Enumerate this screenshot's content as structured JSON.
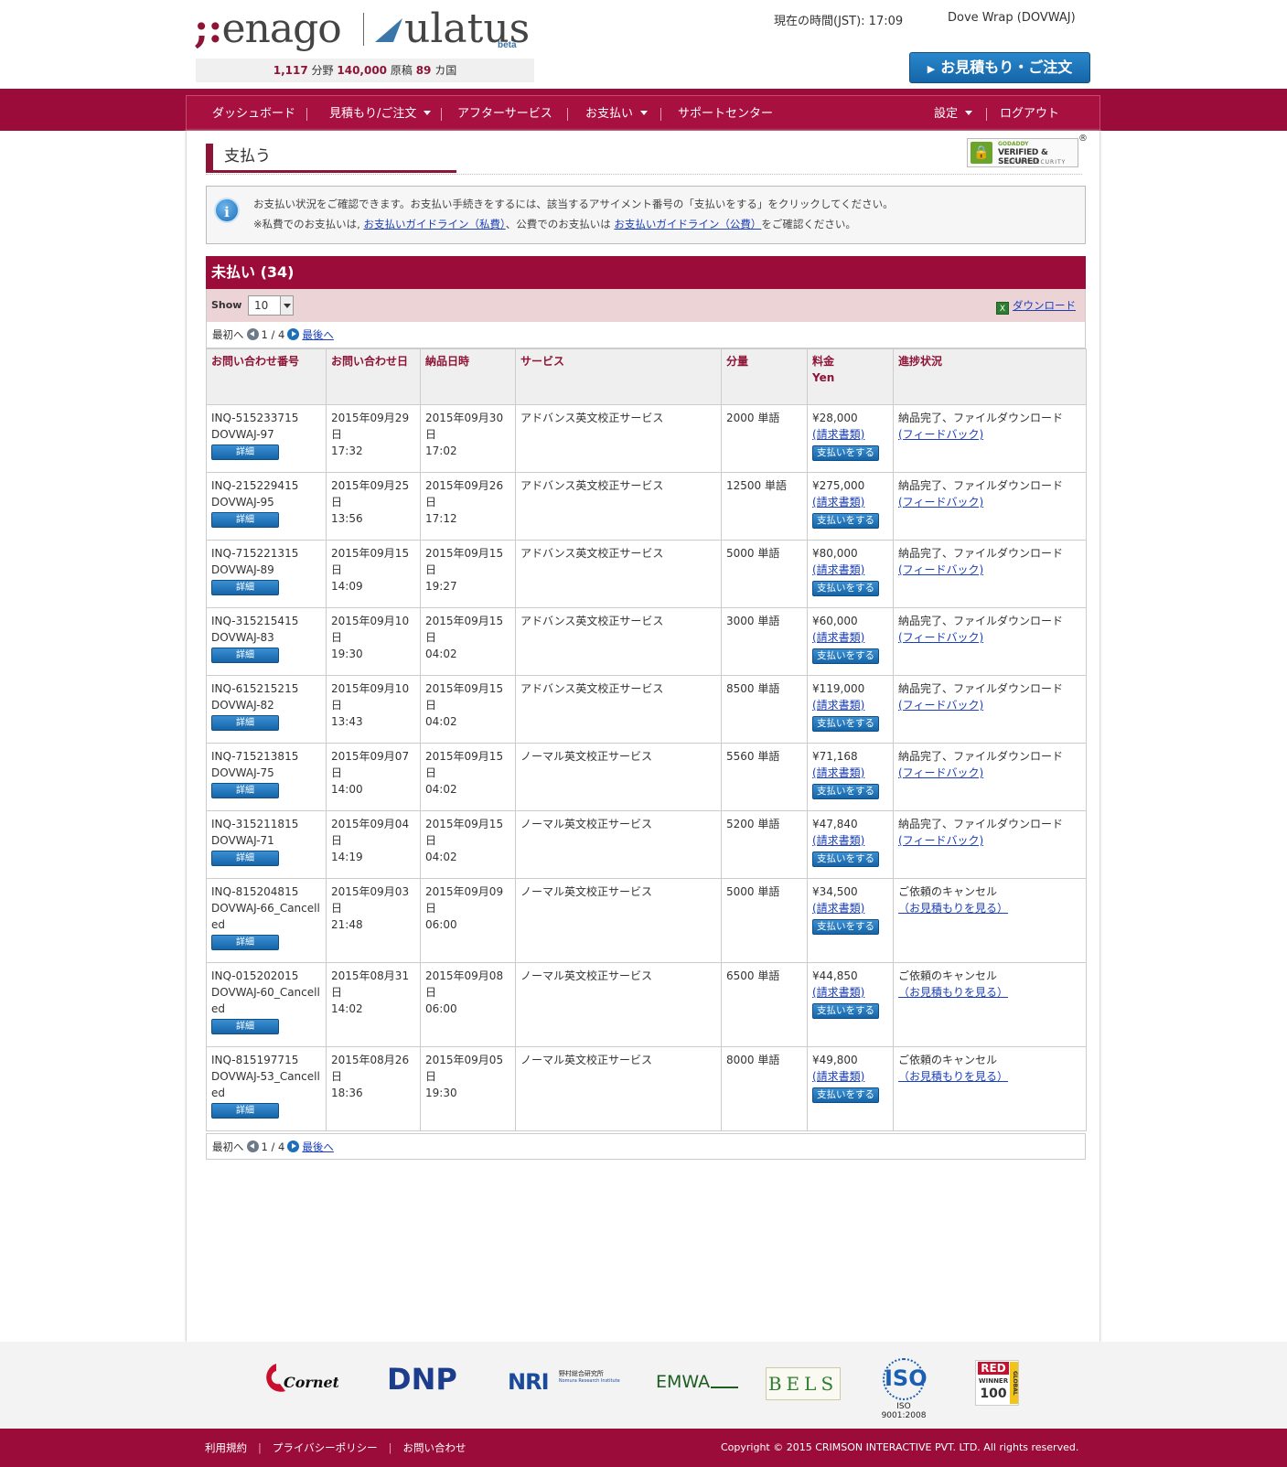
{
  "header": {
    "brand_left": "enago",
    "brand_right": "ulatus",
    "brand_beta": "beta",
    "stats": {
      "fields": "1,117",
      "fields_label": "分野",
      "manuscripts": "140,000",
      "manuscripts_label": "原稿",
      "countries": "89",
      "countries_label": "カ国"
    },
    "clock": "現在の時間(JST): 17:09",
    "user": "Dove Wrap (DOVWAJ)",
    "order_button": "お見積もり・ご注文"
  },
  "nav": {
    "items": [
      "ダッシュボード",
      "見積もり/ご注文",
      "アフターサービス",
      "お支払い",
      "サポートセンター"
    ],
    "settings": "設定",
    "logout": "ログアウト"
  },
  "page": {
    "title": "支払う",
    "badge": {
      "line1": "GODADDY",
      "line2": "VERIFIED & SECURED",
      "line3": "VERIFY SECURITY"
    },
    "info": {
      "line1": "お支払い状況をご確認できます。お支払い手続きをするには、該当するアサイメント番号の「支払いをする」をクリックしてください。",
      "line2_a": "※私費でのお支払いは,",
      "link_private": "お支払いガイドライン（私費）",
      "line2_b": "、公費でのお支払いは",
      "link_public": "お支払いガイドライン（公費）",
      "line2_c": "をご確認ください。"
    }
  },
  "unpaid": {
    "title": "未払い (34)",
    "show_label": "Show",
    "show_value": "10",
    "download": "ダウンロード",
    "pager": {
      "first": "最初へ",
      "page": "1 / 4",
      "last": "最後へ"
    },
    "columns": [
      "お問い合わせ番号",
      "お問い合わせ日",
      "納品日時",
      "サービス",
      "分量",
      "料金",
      "進捗状況"
    ],
    "currency_sub": "Yen",
    "detail_label": "詳細",
    "invoice_label": "(請求書類)",
    "pay_label": "支払いをする",
    "rows": [
      {
        "inq": "INQ-515233715",
        "ref": "DOVWAJ-97",
        "date": "2015年09月29日",
        "time": "17:32",
        "del_date": "2015年09月30日",
        "del_time": "17:02",
        "service": "アドバンス英文校正サービス",
        "qty": "2000 単語",
        "fee": "¥28,000",
        "status": "納品完了、ファイルダウンロード",
        "status_link": "(フィードバック)"
      },
      {
        "inq": "INQ-215229415",
        "ref": "DOVWAJ-95",
        "date": "2015年09月25日",
        "time": "13:56",
        "del_date": "2015年09月26日",
        "del_time": "17:12",
        "service": "アドバンス英文校正サービス",
        "qty": "12500 単語",
        "fee": "¥275,000",
        "status": "納品完了、ファイルダウンロード",
        "status_link": "(フィードバック)"
      },
      {
        "inq": "INQ-715221315",
        "ref": "DOVWAJ-89",
        "date": "2015年09月15日",
        "time": "14:09",
        "del_date": "2015年09月15日",
        "del_time": "19:27",
        "service": "アドバンス英文校正サービス",
        "qty": "5000 単語",
        "fee": "¥80,000",
        "status": "納品完了、ファイルダウンロード",
        "status_link": "(フィードバック)"
      },
      {
        "inq": "INQ-315215415",
        "ref": "DOVWAJ-83",
        "date": "2015年09月10日",
        "time": "19:30",
        "del_date": "2015年09月15日",
        "del_time": "04:02",
        "service": "アドバンス英文校正サービス",
        "qty": "3000 単語",
        "fee": "¥60,000",
        "status": "納品完了、ファイルダウンロード",
        "status_link": "(フィードバック)"
      },
      {
        "inq": "INQ-615215215",
        "ref": "DOVWAJ-82",
        "date": "2015年09月10日",
        "time": "13:43",
        "del_date": "2015年09月15日",
        "del_time": "04:02",
        "service": "アドバンス英文校正サービス",
        "qty": "8500 単語",
        "fee": "¥119,000",
        "status": "納品完了、ファイルダウンロード",
        "status_link": "(フィードバック)"
      },
      {
        "inq": "INQ-715213815",
        "ref": "DOVWAJ-75",
        "date": "2015年09月07日",
        "time": "14:00",
        "del_date": "2015年09月15日",
        "del_time": "04:02",
        "service": "ノーマル英文校正サービス",
        "qty": "5560 単語",
        "fee": "¥71,168",
        "status": "納品完了、ファイルダウンロード",
        "status_link": "(フィードバック)"
      },
      {
        "inq": "INQ-315211815",
        "ref": "DOVWAJ-71",
        "date": "2015年09月04日",
        "time": "14:19",
        "del_date": "2015年09月15日",
        "del_time": "04:02",
        "service": "ノーマル英文校正サービス",
        "qty": "5200 単語",
        "fee": "¥47,840",
        "status": "納品完了、ファイルダウンロード",
        "status_link": "(フィードバック)"
      },
      {
        "inq": "INQ-815204815",
        "ref": "DOVWAJ-66_Cancelled",
        "date": "2015年09月03日",
        "time": "21:48",
        "del_date": "2015年09月09日",
        "del_time": "06:00",
        "service": "ノーマル英文校正サービス",
        "qty": "5000 単語",
        "fee": "¥34,500",
        "status": "ご依頼のキャンセル",
        "status_link": "（お見積もりを見る）"
      },
      {
        "inq": "INQ-015202015",
        "ref": "DOVWAJ-60_Cancelled",
        "date": "2015年08月31日",
        "time": "14:02",
        "del_date": "2015年09月08日",
        "del_time": "06:00",
        "service": "ノーマル英文校正サービス",
        "qty": "6500 単語",
        "fee": "¥44,850",
        "status": "ご依頼のキャンセル",
        "status_link": "（お見積もりを見る）"
      },
      {
        "inq": "INQ-815197715",
        "ref": "DOVWAJ-53_Cancelled",
        "date": "2015年08月26日",
        "time": "18:36",
        "del_date": "2015年09月05日",
        "del_time": "19:30",
        "service": "ノーマル英文校正サービス",
        "qty": "8000 単語",
        "fee": "¥49,800",
        "status": "ご依頼のキャンセル",
        "status_link": "（お見積もりを見る）"
      }
    ]
  },
  "partners": {
    "cornetis": "Cornetis",
    "dnp": "DNP",
    "nri": "NRI",
    "nri_sub": "野村総合研究所",
    "nri_sub_en": "Nomura Research Institute",
    "emwa": "EMWA",
    "bels": "BELS",
    "iso": "ISO",
    "iso_caption": "ISO 9001:2008",
    "red": "RED",
    "red_sub": "WINNER",
    "red_num": "100",
    "red_global": "GLOBAL"
  },
  "footer": {
    "links": [
      "利用規約",
      "プライバシーポリシー",
      "お問い合わせ"
    ],
    "copyright": "Copyright © 2015 CRIMSON INTERACTIVE PVT. LTD. All rights reserved."
  },
  "colors": {
    "brand": "#9b0c3a",
    "button": "#1a6db5",
    "header_text": "#8e1437"
  }
}
